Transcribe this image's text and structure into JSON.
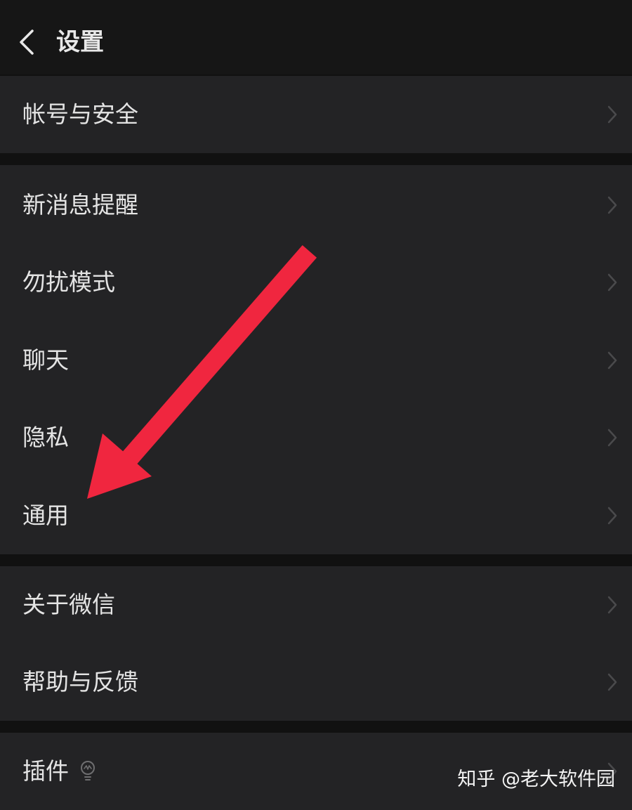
{
  "header": {
    "title": "设置",
    "back_icon": "chevron-left-icon"
  },
  "groups": [
    {
      "items": [
        {
          "label": "帐号与安全"
        }
      ]
    },
    {
      "items": [
        {
          "label": "新消息提醒"
        },
        {
          "label": "勿扰模式"
        },
        {
          "label": "聊天"
        },
        {
          "label": "隐私"
        },
        {
          "label": "通用"
        }
      ]
    },
    {
      "items": [
        {
          "label": "关于微信"
        },
        {
          "label": "帮助与反馈"
        }
      ]
    },
    {
      "items": [
        {
          "label": "插件",
          "icon": "lightbulb-icon"
        }
      ]
    }
  ],
  "annotation": {
    "icon": "red-arrow-icon",
    "color": "#f0263f"
  },
  "watermark": {
    "text": "知乎 @老大软件园"
  },
  "colors": {
    "background": "#111111",
    "header": "#161616",
    "cell": "#232325",
    "text": "#e4e4e4",
    "chevron": "#4a4a4c"
  }
}
